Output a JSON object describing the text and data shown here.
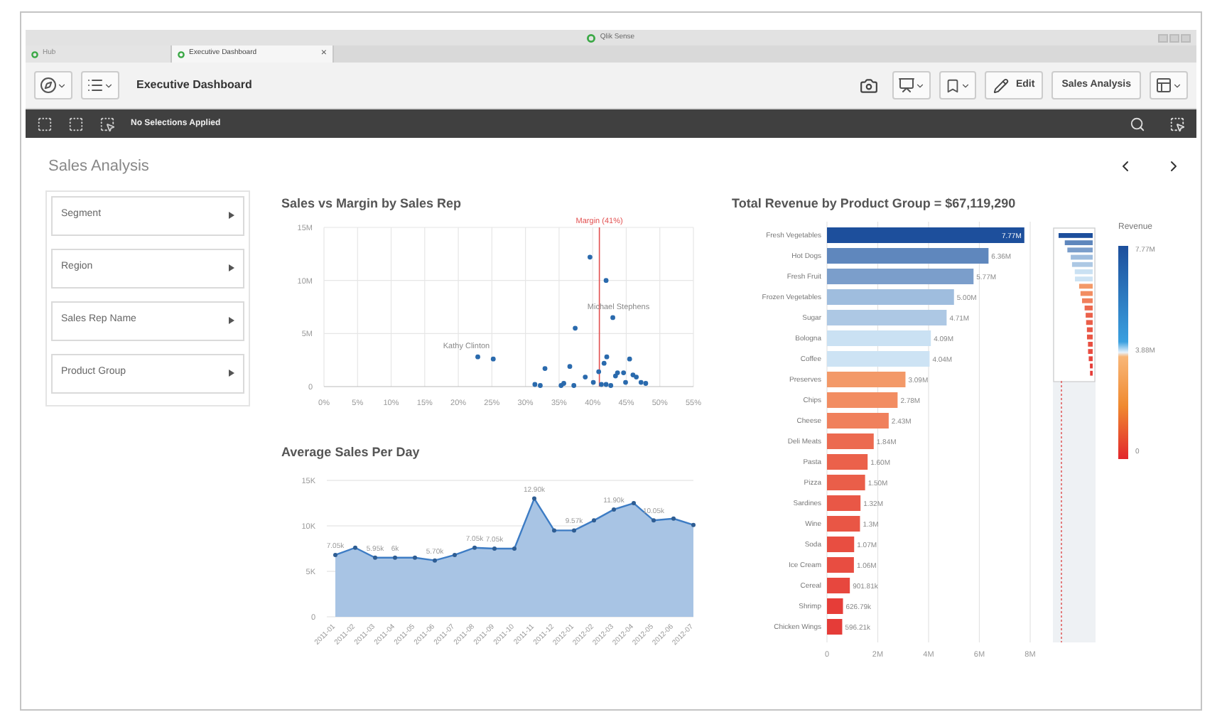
{
  "window": {
    "title": "Qlik Sense"
  },
  "tabs": [
    {
      "label": "Hub",
      "selected": false
    },
    {
      "label": "Executive Dashboard",
      "selected": true,
      "close": "×"
    }
  ],
  "toolbar": {
    "app_title": "Executive Dashboard",
    "edit_label": "Edit",
    "sheet_button": "Sales Analysis"
  },
  "selection_bar": {
    "status": "No Selections Applied"
  },
  "sheet": {
    "title": "Sales Analysis"
  },
  "filters": [
    {
      "label": "Segment"
    },
    {
      "label": "Region"
    },
    {
      "label": "Sales Rep Name"
    },
    {
      "label": "Product Group"
    }
  ],
  "scatter": {
    "chart_data": {
      "type": "scatter",
      "title": "Sales vs Margin by Sales Rep",
      "grid": true,
      "xlim": [
        0,
        55
      ],
      "ylim": [
        0,
        15
      ],
      "xticks": [
        {
          "value": 0,
          "label": "0%"
        },
        {
          "value": 5,
          "label": "5%"
        },
        {
          "value": 10,
          "label": "10%"
        },
        {
          "value": 15,
          "label": "15%"
        },
        {
          "value": 20,
          "label": "20%"
        },
        {
          "value": 25,
          "label": "25%"
        },
        {
          "value": 30,
          "label": "30%"
        },
        {
          "value": 35,
          "label": "35%"
        },
        {
          "value": 40,
          "label": "40%"
        },
        {
          "value": 45,
          "label": "45%"
        },
        {
          "value": 50,
          "label": "50%"
        },
        {
          "value": 55,
          "label": "55%"
        }
      ],
      "yticks": [
        {
          "value": 0,
          "label": "0"
        },
        {
          "value": 5,
          "label": "5M"
        },
        {
          "value": 10,
          "label": "10M"
        },
        {
          "value": 15,
          "label": "15M"
        }
      ],
      "x": [
        22.9,
        25.2,
        32.9,
        31.4,
        32.2,
        35.3,
        35.7,
        36.6,
        37.4,
        37.2,
        38.9,
        39.6,
        40.1,
        40.9,
        41.7,
        42.1,
        42.0,
        43.0,
        41.3,
        42.0,
        42.7,
        43.4,
        43.7,
        44.6,
        45.5,
        44.9,
        46.0,
        46.5,
        47.2,
        47.9
      ],
      "series": [
        {
          "color": "#2a6aad",
          "values": [
            2.8,
            2.6,
            1.7,
            0.2,
            0.1,
            0.1,
            0.3,
            1.9,
            5.5,
            0.1,
            0.9,
            12.2,
            0.4,
            1.4,
            2.2,
            2.8,
            10.0,
            6.5,
            0.2,
            0.2,
            0.1,
            1.0,
            1.3,
            1.3,
            2.6,
            0.4,
            1.1,
            0.9,
            0.4,
            0.3
          ]
        }
      ],
      "ref_lines": [
        {
          "axis": "x",
          "value": 41,
          "label": "Margin (41%)",
          "color": "#e25050"
        }
      ],
      "annotations": [
        {
          "text": "Kathy Clinton",
          "x": 22.9,
          "y": 2.8
        },
        {
          "text": "Michael Stephens",
          "x": 43.0,
          "y": 6.5
        }
      ]
    }
  },
  "area": {
    "chart_data": {
      "type": "area",
      "title": "Average Sales Per Day",
      "grid": true,
      "ylim": [
        0,
        15
      ],
      "categories": [
        "2011-01",
        "2011-02",
        "2011-03",
        "2011-04",
        "2011-05",
        "2011-06",
        "2011-07",
        "2011-08",
        "2011-09",
        "2011-10",
        "2011-11",
        "2011-12",
        "2012-01",
        "2012-02",
        "2012-03",
        "2012-04",
        "2012-05",
        "2012-06",
        "2012-07"
      ],
      "yticks": [
        {
          "value": 0,
          "label": "0"
        },
        {
          "value": 5,
          "label": "5K"
        },
        {
          "value": 10,
          "label": "10K"
        },
        {
          "value": 15,
          "label": "15K"
        }
      ],
      "series": [
        {
          "color": "#3d7cc4",
          "values": [
            6.8,
            7.6,
            6.5,
            6.5,
            6.5,
            6.2,
            6.8,
            7.6,
            7.5,
            7.5,
            13.0,
            9.5,
            9.5,
            10.6,
            11.8,
            12.5,
            10.6,
            10.8,
            10.1
          ]
        }
      ],
      "value_labels": [
        "7.05k",
        null,
        "5.95k",
        "6k",
        null,
        "5.70k",
        null,
        "7.05k",
        "7.05k",
        null,
        "12.90k",
        null,
        "9.57k",
        null,
        "11.90k",
        null,
        "10.05k",
        null,
        null
      ]
    }
  },
  "revenue": {
    "chart_data": {
      "type": "bar",
      "orientation": "horizontal",
      "title": "Total Revenue by Product Group = $67,119,290",
      "grid": true,
      "xlim": [
        0,
        8
      ],
      "xticks": [
        {
          "value": 0,
          "label": "0"
        },
        {
          "value": 2,
          "label": "2M"
        },
        {
          "value": 4,
          "label": "4M"
        },
        {
          "value": 6,
          "label": "6M"
        },
        {
          "value": 8,
          "label": "8M"
        }
      ],
      "categories": [
        "Fresh Vegetables",
        "Hot Dogs",
        "Fresh Fruit",
        "Frozen Vegetables",
        "Sugar",
        "Bologna",
        "Coffee",
        "Preserves",
        "Chips",
        "Cheese",
        "Deli Meats",
        "Pasta",
        "Pizza",
        "Sardines",
        "Wine",
        "Soda",
        "Ice Cream",
        "Cereal",
        "Shrimp",
        "Chicken Wings"
      ],
      "series": [
        {
          "name": "Revenue",
          "values": [
            7.77,
            6.36,
            5.77,
            5.0,
            4.71,
            4.09,
            4.04,
            3.09,
            2.78,
            2.43,
            1.84,
            1.6,
            1.5,
            1.32,
            1.3,
            1.07,
            1.06,
            0.9,
            0.63,
            0.6
          ]
        }
      ],
      "value_labels": [
        "7.77M",
        "6.36M",
        "5.77M",
        "5.00M",
        "4.71M",
        "4.09M",
        "4.04M",
        "3.09M",
        "2.78M",
        "2.43M",
        "1.84M",
        "1.60M",
        "1.50M",
        "1.32M",
        "1.3M",
        "1.07M",
        "1.06M",
        "901.81k",
        "626.79k",
        "596.21k"
      ]
    },
    "legend": {
      "max": "7.77M",
      "mid": "3.88M",
      "min": "0"
    }
  }
}
